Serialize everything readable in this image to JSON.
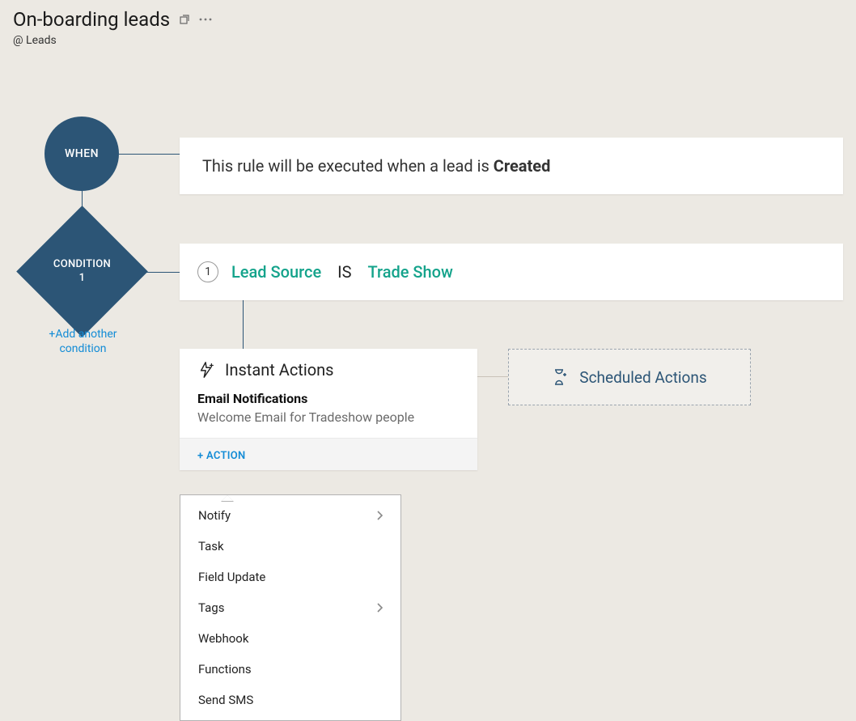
{
  "header": {
    "title": "On-boarding leads",
    "subtitle": "@ Leads"
  },
  "when": {
    "label": "WHEN",
    "text_prefix": "This rule will be executed when a lead is ",
    "trigger": "Created"
  },
  "condition": {
    "label_line1": "CONDITION",
    "label_line2": "1",
    "number": "1",
    "field": "Lead Source",
    "operator": "IS",
    "value": "Trade Show",
    "add_another": "+Add another condition"
  },
  "instant": {
    "title": "Instant Actions",
    "section": "Email Notifications",
    "item": "Welcome Email for Tradeshow people",
    "add_action": "+ ACTION"
  },
  "scheduled": {
    "title": "Scheduled Actions"
  },
  "dropdown": {
    "items": [
      {
        "label": "Notify",
        "sub": true
      },
      {
        "label": "Task",
        "sub": false
      },
      {
        "label": "Field Update",
        "sub": false
      },
      {
        "label": "Tags",
        "sub": true
      },
      {
        "label": "Webhook",
        "sub": false
      },
      {
        "label": "Functions",
        "sub": false
      },
      {
        "label": "Send SMS",
        "sub": false
      }
    ]
  }
}
